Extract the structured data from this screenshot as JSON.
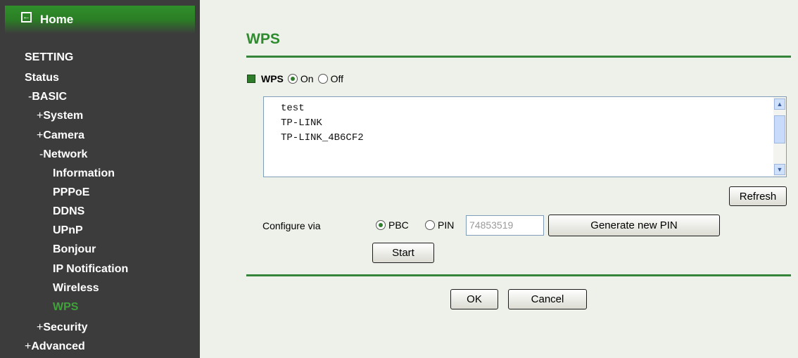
{
  "sidebar": {
    "home_label": "Home",
    "home_icon": "back-arrow-icon",
    "items": [
      {
        "prefix": "",
        "label": "SETTING"
      },
      {
        "prefix": "",
        "label": "Status"
      },
      {
        "prefix": "-",
        "label": "BASIC"
      },
      {
        "prefix": "+",
        "label": "System"
      },
      {
        "prefix": "+",
        "label": "Camera"
      },
      {
        "prefix": "-",
        "label": "Network"
      },
      {
        "prefix": "",
        "label": "Information"
      },
      {
        "prefix": "",
        "label": "PPPoE"
      },
      {
        "prefix": "",
        "label": "DDNS"
      },
      {
        "prefix": "",
        "label": "UPnP"
      },
      {
        "prefix": "",
        "label": "Bonjour"
      },
      {
        "prefix": "",
        "label": "IP Notification"
      },
      {
        "prefix": "",
        "label": "Wireless"
      },
      {
        "prefix": "",
        "label": "WPS"
      },
      {
        "prefix": "+",
        "label": "Security"
      },
      {
        "prefix": "+",
        "label": "Advanced"
      }
    ],
    "active_item": "WPS",
    "active_color": "#3fa33a"
  },
  "main": {
    "title": "WPS",
    "wps_toggle": {
      "label": "WPS",
      "on_label": "On",
      "off_label": "Off",
      "selected": "On"
    },
    "networks": [
      "test",
      "TP-LINK",
      "TP-LINK_4B6CF2"
    ],
    "refresh_label": "Refresh",
    "configure": {
      "label": "Configure via",
      "pbc_label": "PBC",
      "pin_label": "PIN",
      "selected": "PBC",
      "pin_value": "74853519",
      "generate_label": "Generate new PIN",
      "start_label": "Start"
    },
    "ok_label": "OK",
    "cancel_label": "Cancel"
  },
  "colors": {
    "accent": "#2e8b2e",
    "sidebar_bg": "#3c3c3c",
    "page_bg": "#eef1ea"
  }
}
